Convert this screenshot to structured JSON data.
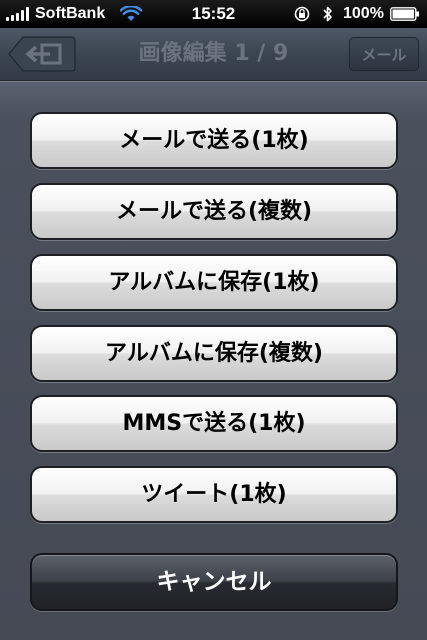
{
  "status_bar": {
    "carrier": "SoftBank",
    "time": "15:52",
    "battery": "100%",
    "icons": [
      "signal-bars-icon",
      "wifi-icon",
      "orientation-lock-icon",
      "bluetooth-icon",
      "battery-icon"
    ]
  },
  "navbar": {
    "back_icon": "back-arrow-icon",
    "title": "画像編集 1 / 9",
    "mail_button": "メール"
  },
  "action_sheet": {
    "buttons": [
      {
        "label": "メールで送る(1枚)"
      },
      {
        "label": "メールで送る(複数)"
      },
      {
        "label": "アルバムに保存(1枚)"
      },
      {
        "label": "アルバムに保存(複数)"
      },
      {
        "label": "MMSで送る(1枚)"
      },
      {
        "label": "ツイート(1枚)"
      }
    ],
    "cancel": "キャンセル"
  },
  "colors": {
    "button_text": "#000000",
    "cancel_text": "#ffffff",
    "sheet_background": "#4a505c"
  }
}
